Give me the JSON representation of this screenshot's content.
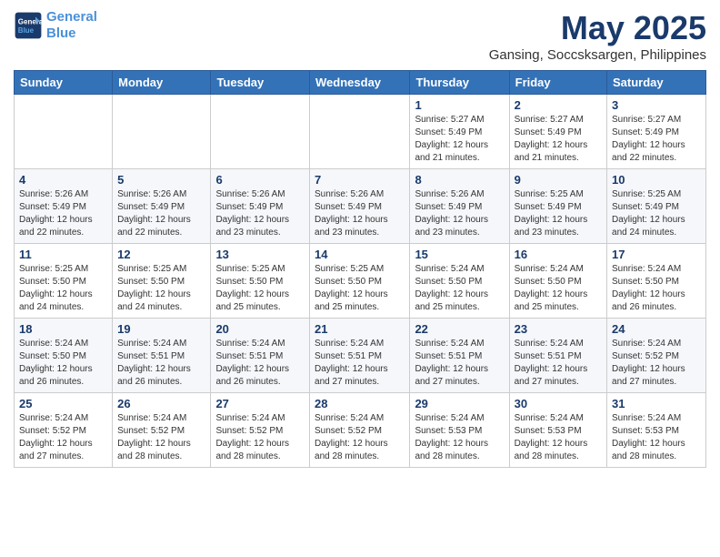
{
  "logo": {
    "line1": "General",
    "line2": "Blue"
  },
  "title": "May 2025",
  "subtitle": "Gansing, Soccsksargen, Philippines",
  "weekdays": [
    "Sunday",
    "Monday",
    "Tuesday",
    "Wednesday",
    "Thursday",
    "Friday",
    "Saturday"
  ],
  "weeks": [
    [
      {
        "day": "",
        "info": ""
      },
      {
        "day": "",
        "info": ""
      },
      {
        "day": "",
        "info": ""
      },
      {
        "day": "",
        "info": ""
      },
      {
        "day": "1",
        "info": "Sunrise: 5:27 AM\nSunset: 5:49 PM\nDaylight: 12 hours\nand 21 minutes."
      },
      {
        "day": "2",
        "info": "Sunrise: 5:27 AM\nSunset: 5:49 PM\nDaylight: 12 hours\nand 21 minutes."
      },
      {
        "day": "3",
        "info": "Sunrise: 5:27 AM\nSunset: 5:49 PM\nDaylight: 12 hours\nand 22 minutes."
      }
    ],
    [
      {
        "day": "4",
        "info": "Sunrise: 5:26 AM\nSunset: 5:49 PM\nDaylight: 12 hours\nand 22 minutes."
      },
      {
        "day": "5",
        "info": "Sunrise: 5:26 AM\nSunset: 5:49 PM\nDaylight: 12 hours\nand 22 minutes."
      },
      {
        "day": "6",
        "info": "Sunrise: 5:26 AM\nSunset: 5:49 PM\nDaylight: 12 hours\nand 23 minutes."
      },
      {
        "day": "7",
        "info": "Sunrise: 5:26 AM\nSunset: 5:49 PM\nDaylight: 12 hours\nand 23 minutes."
      },
      {
        "day": "8",
        "info": "Sunrise: 5:26 AM\nSunset: 5:49 PM\nDaylight: 12 hours\nand 23 minutes."
      },
      {
        "day": "9",
        "info": "Sunrise: 5:25 AM\nSunset: 5:49 PM\nDaylight: 12 hours\nand 23 minutes."
      },
      {
        "day": "10",
        "info": "Sunrise: 5:25 AM\nSunset: 5:49 PM\nDaylight: 12 hours\nand 24 minutes."
      }
    ],
    [
      {
        "day": "11",
        "info": "Sunrise: 5:25 AM\nSunset: 5:50 PM\nDaylight: 12 hours\nand 24 minutes."
      },
      {
        "day": "12",
        "info": "Sunrise: 5:25 AM\nSunset: 5:50 PM\nDaylight: 12 hours\nand 24 minutes."
      },
      {
        "day": "13",
        "info": "Sunrise: 5:25 AM\nSunset: 5:50 PM\nDaylight: 12 hours\nand 25 minutes."
      },
      {
        "day": "14",
        "info": "Sunrise: 5:25 AM\nSunset: 5:50 PM\nDaylight: 12 hours\nand 25 minutes."
      },
      {
        "day": "15",
        "info": "Sunrise: 5:24 AM\nSunset: 5:50 PM\nDaylight: 12 hours\nand 25 minutes."
      },
      {
        "day": "16",
        "info": "Sunrise: 5:24 AM\nSunset: 5:50 PM\nDaylight: 12 hours\nand 25 minutes."
      },
      {
        "day": "17",
        "info": "Sunrise: 5:24 AM\nSunset: 5:50 PM\nDaylight: 12 hours\nand 26 minutes."
      }
    ],
    [
      {
        "day": "18",
        "info": "Sunrise: 5:24 AM\nSunset: 5:50 PM\nDaylight: 12 hours\nand 26 minutes."
      },
      {
        "day": "19",
        "info": "Sunrise: 5:24 AM\nSunset: 5:51 PM\nDaylight: 12 hours\nand 26 minutes."
      },
      {
        "day": "20",
        "info": "Sunrise: 5:24 AM\nSunset: 5:51 PM\nDaylight: 12 hours\nand 26 minutes."
      },
      {
        "day": "21",
        "info": "Sunrise: 5:24 AM\nSunset: 5:51 PM\nDaylight: 12 hours\nand 27 minutes."
      },
      {
        "day": "22",
        "info": "Sunrise: 5:24 AM\nSunset: 5:51 PM\nDaylight: 12 hours\nand 27 minutes."
      },
      {
        "day": "23",
        "info": "Sunrise: 5:24 AM\nSunset: 5:51 PM\nDaylight: 12 hours\nand 27 minutes."
      },
      {
        "day": "24",
        "info": "Sunrise: 5:24 AM\nSunset: 5:52 PM\nDaylight: 12 hours\nand 27 minutes."
      }
    ],
    [
      {
        "day": "25",
        "info": "Sunrise: 5:24 AM\nSunset: 5:52 PM\nDaylight: 12 hours\nand 27 minutes."
      },
      {
        "day": "26",
        "info": "Sunrise: 5:24 AM\nSunset: 5:52 PM\nDaylight: 12 hours\nand 28 minutes."
      },
      {
        "day": "27",
        "info": "Sunrise: 5:24 AM\nSunset: 5:52 PM\nDaylight: 12 hours\nand 28 minutes."
      },
      {
        "day": "28",
        "info": "Sunrise: 5:24 AM\nSunset: 5:52 PM\nDaylight: 12 hours\nand 28 minutes."
      },
      {
        "day": "29",
        "info": "Sunrise: 5:24 AM\nSunset: 5:53 PM\nDaylight: 12 hours\nand 28 minutes."
      },
      {
        "day": "30",
        "info": "Sunrise: 5:24 AM\nSunset: 5:53 PM\nDaylight: 12 hours\nand 28 minutes."
      },
      {
        "day": "31",
        "info": "Sunrise: 5:24 AM\nSunset: 5:53 PM\nDaylight: 12 hours\nand 28 minutes."
      }
    ]
  ]
}
